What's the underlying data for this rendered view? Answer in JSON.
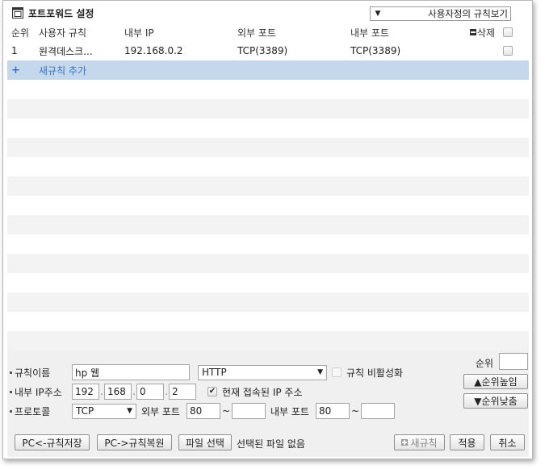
{
  "header": {
    "title": "포트포워드 설정",
    "view_select": "사용자정의 규칙보기"
  },
  "table": {
    "columns": [
      "순위",
      "사용자 규칙",
      "내부 IP",
      "외부 포트",
      "내부 포트",
      "삭제"
    ],
    "rows": [
      {
        "order": "1",
        "rule": "원격데스크...",
        "inner_ip": "192.168.0.2",
        "external_port": "TCP(3389)",
        "internal_port": "TCP(3389)"
      }
    ],
    "add_rule_label": "새규칙 추가",
    "add_icon": "+"
  },
  "form": {
    "rule_name_label": "규칙이름",
    "rule_name_value": "hp 웹",
    "service_select": "HTTP",
    "disable_rule_label": "규칙 비활성화",
    "inner_ip_label": "내부 IP주소",
    "ip": [
      "192",
      "168",
      "0",
      "2"
    ],
    "current_ip_label": "현재 접속된 IP 주소",
    "current_ip_checked": true,
    "protocol_label": "프로토콜",
    "protocol_value": "TCP",
    "external_port_label": "외부 포트",
    "external_port_from": "80",
    "external_port_to": "",
    "internal_port_label": "내부 포트",
    "internal_port_from": "80",
    "internal_port_to": "",
    "tilde": "~",
    "ip_dot": ".",
    "order_label": "순위",
    "order_value": "",
    "raise_label": "▲순위높임",
    "lower_label": "▼순위낮춤"
  },
  "footer": {
    "save_pc": "PC<-규칙저장",
    "restore_pc": "PC->규칙복원",
    "file_select": "파일 선택",
    "file_status": "선택된 파일 없음",
    "new_rule": "새규칙",
    "apply": "적용",
    "cancel": "취소"
  }
}
